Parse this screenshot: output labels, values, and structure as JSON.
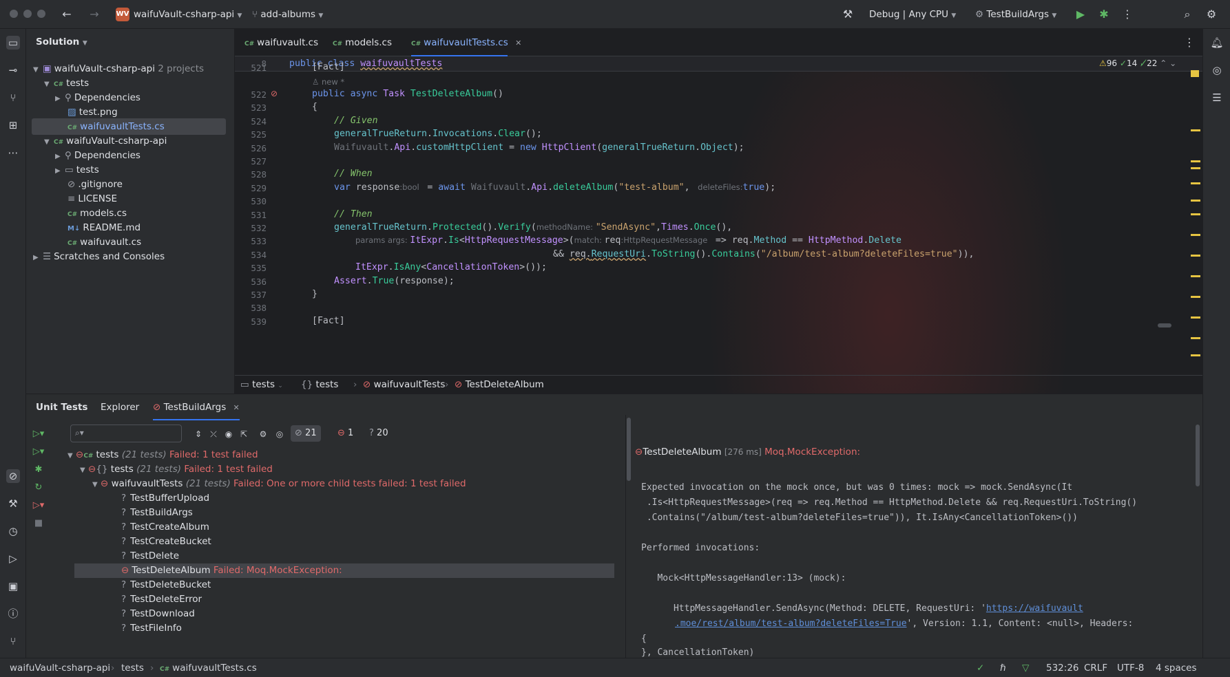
{
  "titlebar": {
    "project_badge": "WV",
    "project_name": "waifuVault-csharp-api",
    "branch": "add-albums",
    "run_config": "Debug | Any CPU",
    "build_args": "TestBuildArgs"
  },
  "project_panel": {
    "title": "Solution",
    "items": [
      {
        "label": "waifuVault-csharp-api",
        "meta": "2 projects"
      },
      {
        "label": "tests"
      },
      {
        "label": "Dependencies"
      },
      {
        "label": "test.png"
      },
      {
        "label": "waifuvaultTests.cs"
      },
      {
        "label": "waifuVault-csharp-api"
      },
      {
        "label": "Dependencies"
      },
      {
        "label": "tests"
      },
      {
        "label": ".gitignore"
      },
      {
        "label": "LICENSE"
      },
      {
        "label": "models.cs"
      },
      {
        "label": "README.md"
      },
      {
        "label": "waifuvault.cs"
      },
      {
        "label": "Scratches and Consoles"
      }
    ]
  },
  "editor": {
    "tabs": [
      {
        "label": "waifuvault.cs"
      },
      {
        "label": "models.cs"
      },
      {
        "label": "waifuvaultTests.cs"
      }
    ],
    "inspections": {
      "warnings": "96",
      "ok": "14",
      "typos": "22"
    },
    "sticky_line_no": "8",
    "sticky_code": "public class waifuvaultTests",
    "author_hint": "new *",
    "line_numbers": [
      "521",
      "522",
      "523",
      "524",
      "525",
      "526",
      "527",
      "528",
      "529",
      "530",
      "531",
      "532",
      "533",
      "534",
      "535",
      "536",
      "537",
      "538",
      "539"
    ],
    "breadcrumb": [
      "tests",
      "tests",
      "waifuvaultTests",
      "TestDeleteAlbum"
    ]
  },
  "unit_tests": {
    "tabs": [
      "Unit Tests",
      "Explorer",
      "TestBuildArgs"
    ],
    "counts": {
      "total": "21",
      "failed": "1",
      "unknown": "20"
    },
    "tree": {
      "root": {
        "label": "tests",
        "meta": "(21 tests)",
        "status": "Failed: 1 test failed"
      },
      "ns": {
        "label": "tests",
        "meta": "(21 tests)",
        "status": "Failed: 1 test failed"
      },
      "cls": {
        "label": "waifuvaultTests",
        "meta": "(21 tests)",
        "status": "Failed: One or more child tests failed: 1 test failed"
      },
      "tests": [
        "TestBufferUpload",
        "TestBuildArgs",
        "TestCreateAlbum",
        "TestCreateBucket",
        "TestDelete",
        "TestDeleteAlbum",
        "TestDeleteBucket",
        "TestDeleteError",
        "TestDownload",
        "TestFileInfo"
      ],
      "failed_status": "Failed: Moq.MockException:"
    },
    "output": {
      "test": "TestDeleteAlbum",
      "duration": "[276 ms]",
      "exception": "Moq.MockException:",
      "lines": [
        "Expected invocation on the mock once, but was 0 times: mock => mock.SendAsync(It",
        " .Is<HttpRequestMessage>(req => req.Method == HttpMethod.Delete && req.RequestUri.ToString()",
        " .Contains(\"/album/test-album?deleteFiles=true\")), It.IsAny<CancellationToken>())",
        "",
        "Performed invocations:",
        "",
        "   Mock<HttpMessageHandler:13> (mock):",
        "",
        "      HttpMessageHandler.SendAsync(Method: DELETE, RequestUri: '"
      ],
      "url1": "https://waifuvault",
      "url2": ".moe/rest/album/test-album?deleteFiles=True",
      "after_url": "', Version: 1.1, Content: <null>, Headers:",
      "line_brace": "{",
      "line_last": "}, CancellationToken)"
    }
  },
  "statusbar": {
    "path": [
      "waifuVault-csharp-api",
      "tests",
      "waifuvaultTests.cs"
    ],
    "position": "532:26",
    "line_sep": "CRLF",
    "encoding": "UTF-8",
    "indent": "4 spaces"
  }
}
